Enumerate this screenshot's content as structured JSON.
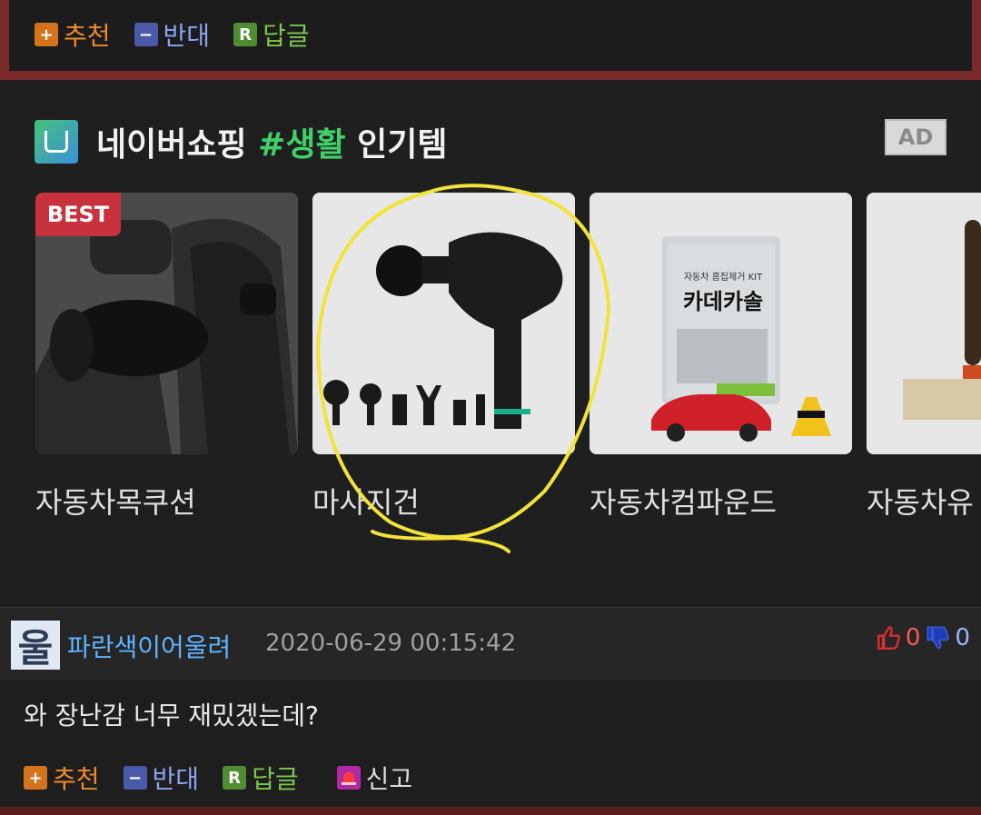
{
  "top_actions": {
    "recommend": "추천",
    "oppose": "반대",
    "reply": "답글"
  },
  "icons": {
    "plus": "+",
    "minus": "−",
    "reply": "R"
  },
  "ad": {
    "title_prefix": "네이버쇼핑",
    "title_hash": "#생활",
    "title_suffix": "인기템",
    "badge": "AD"
  },
  "products": [
    {
      "name": "자동차목쿠션",
      "badge": "BEST"
    },
    {
      "name": "마사지건"
    },
    {
      "name": "자동차컴파운드",
      "box_small": "자동차 흠집제거 KIT",
      "box_big": "카데카솔"
    },
    {
      "name": "자동차유"
    }
  ],
  "comment": {
    "avatar_char": "울",
    "nick": "파란색이어울려",
    "date": "2020-06-29 00:15:42",
    "upvotes": "0",
    "downvotes": "0",
    "text": "와 장난감 너무 재밌겠는데?",
    "actions": {
      "recommend": "추천",
      "oppose": "반대",
      "reply": "답글",
      "report": "신고"
    }
  },
  "colors": {
    "accent_green": "#3ed16a",
    "nick_blue": "#5fb3ff",
    "border_red": "#7a2a2a",
    "annotation_yellow": "#f2e33a"
  }
}
